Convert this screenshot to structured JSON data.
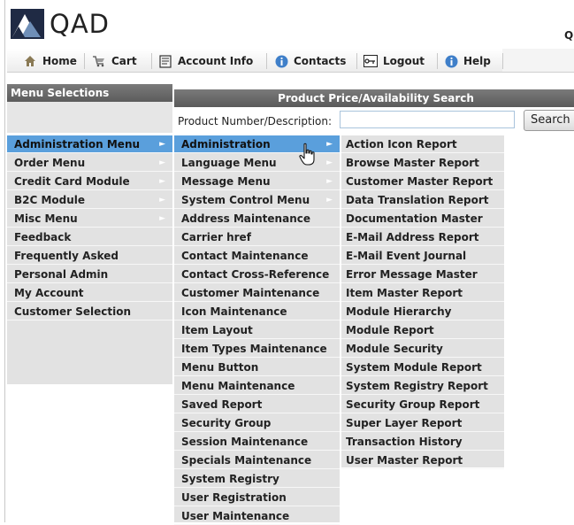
{
  "header": {
    "logo_text": "QAD",
    "corner_text": "Q"
  },
  "nav": {
    "tabs": [
      {
        "label": "Home",
        "icon": "home-icon"
      },
      {
        "label": "Cart",
        "icon": "cart-icon"
      },
      {
        "label": "Account Info",
        "icon": "account-info-icon"
      },
      {
        "label": "Contacts",
        "icon": "info-icon"
      },
      {
        "label": "Logout",
        "icon": "logout-icon"
      },
      {
        "label": "Help",
        "icon": "help-icon"
      }
    ]
  },
  "menu": {
    "title": "Menu Selections",
    "items": [
      "Administration Menu",
      "Order Menu",
      "Credit Card Module",
      "B2C Module",
      "Misc Menu",
      "Feedback",
      "Frequently Asked",
      "Personal Admin",
      "My Account",
      "Customer Selection"
    ],
    "submenu": [
      "Administration",
      "Language Menu",
      "Message Menu",
      "System Control Menu",
      "Address Maintenance",
      "Carrier href",
      "Contact Maintenance",
      "Contact Cross-Reference",
      "Customer Maintenance",
      "Icon Maintenance",
      "Item Layout",
      "Item Types Maintenance",
      "Menu Button",
      "Menu Maintenance",
      "Saved Report",
      "Security Group",
      "Session Maintenance",
      "Specials Maintenance",
      "System Registry",
      "User Registration",
      "User Maintenance"
    ],
    "subsubmenu": [
      "Action Icon Report",
      "Browse Master Report",
      "Customer Master Report",
      "Data Translation Report",
      "Documentation Master",
      "E-Mail Address Report",
      "E-Mail Event Journal",
      "Error Message Master",
      "Item Master Report",
      "Module Hierarchy",
      "Module Report",
      "Module Security",
      "System Module Report",
      "System Registry Report",
      "Security Group Report",
      "Super Layer Report",
      "Transaction History",
      "User Master Report"
    ]
  },
  "search": {
    "title": "Product Price/Availability Search",
    "label": "Product Number/Description:",
    "value": "",
    "placeholder": "",
    "button": "Search"
  },
  "colors": {
    "accent": "#5a9fdc",
    "panel": "#e2e2e2",
    "header": "#666666"
  }
}
